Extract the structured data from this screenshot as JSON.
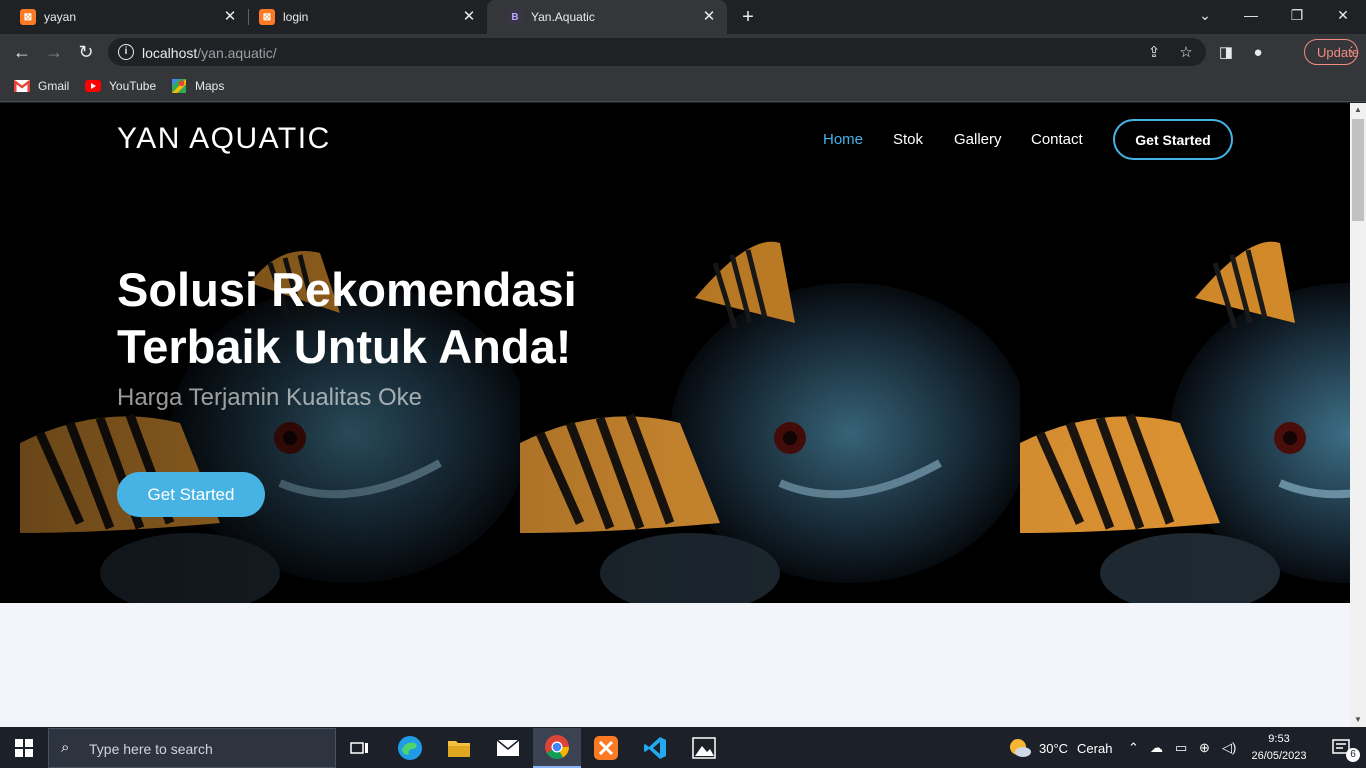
{
  "browser": {
    "tabs": [
      {
        "title": "yayan",
        "favicon": "xampp-icon"
      },
      {
        "title": "login",
        "favicon": "xampp-icon"
      },
      {
        "title": "Yan.Aquatic",
        "favicon": "bootstrap-icon",
        "favicon_letter": "B"
      }
    ],
    "url": {
      "host": "localhost",
      "path": "/yan.aquatic/"
    },
    "update_label": "Update",
    "bookmarks": [
      {
        "label": "Gmail",
        "icon": "gmail-icon"
      },
      {
        "label": "YouTube",
        "icon": "youtube-icon"
      },
      {
        "label": "Maps",
        "icon": "maps-icon"
      }
    ]
  },
  "site": {
    "logo": "YAN AQUATIC",
    "nav": [
      "Home",
      "Stok",
      "Gallery",
      "Contact"
    ],
    "nav_cta": "Get Started",
    "hero": {
      "title_line1": "Solusi Rekomendasi",
      "title_line2": "Terbaik Untuk Anda!",
      "subtitle": "Harga Terjamin Kualitas Oke",
      "cta": "Get Started"
    },
    "accent": "#47b2e4"
  },
  "taskbar": {
    "search_placeholder": "Type here to search",
    "weather": {
      "temp": "30°C",
      "condition": "Cerah"
    },
    "time": "9:53",
    "date": "26/05/2023",
    "notification_count": "6"
  }
}
